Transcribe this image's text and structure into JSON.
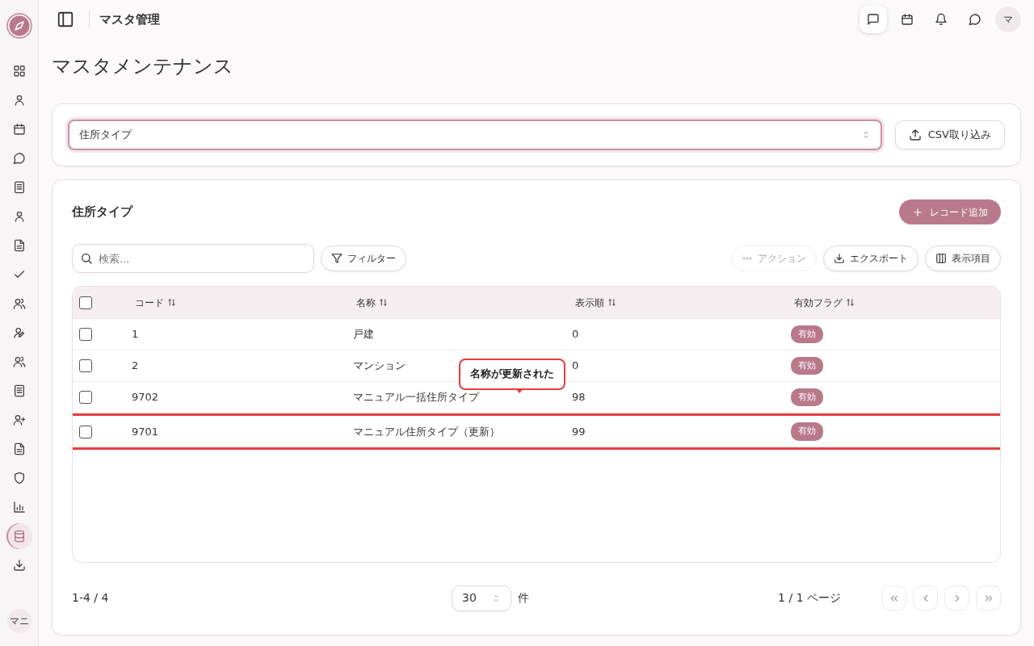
{
  "sidebar": {
    "items": [
      {
        "selected": false
      },
      {
        "selected": false
      },
      {
        "selected": false
      },
      {
        "selected": false
      },
      {
        "selected": false
      },
      {
        "selected": false
      },
      {
        "selected": false
      },
      {
        "selected": false
      },
      {
        "selected": false
      },
      {
        "selected": false
      },
      {
        "selected": false
      },
      {
        "selected": false
      },
      {
        "selected": false
      },
      {
        "selected": false
      },
      {
        "selected": false
      },
      {
        "selected": false
      },
      {
        "selected": true
      },
      {
        "selected": false
      }
    ],
    "user_avatar": "マニ"
  },
  "topbar": {
    "title": "マスタ管理",
    "avatar": "マ"
  },
  "page_title": "マスタメンテナンス",
  "master_select": {
    "value": "住所タイプ"
  },
  "import_button": "CSV取り込み",
  "section": {
    "title": "住所タイプ",
    "add_button": "レコード追加"
  },
  "search": {
    "placeholder": "検索..."
  },
  "filter_button": "フィルター",
  "toolbar": [
    {
      "label": "アクション",
      "disabled": true
    },
    {
      "label": "エクスポート",
      "disabled": false
    },
    {
      "label": "表示項目",
      "disabled": false
    }
  ],
  "table": {
    "select_all": {
      "checked": false
    },
    "columns": [
      "コード",
      "名称",
      "表示順",
      "有効フラグ"
    ],
    "rows": [
      {
        "checked": false,
        "highlighted": false,
        "cells": [
          "1",
          "戸建",
          "0",
          "有効"
        ]
      },
      {
        "checked": false,
        "highlighted": false,
        "cells": [
          "2",
          "マンション",
          "0",
          "有効"
        ]
      },
      {
        "checked": false,
        "highlighted": false,
        "cells": [
          "9702",
          "マニュアル一括住所タイプ",
          "98",
          "有効"
        ]
      },
      {
        "checked": false,
        "highlighted": true,
        "cells": [
          "9701",
          "マニュアル住所タイプ（更新）",
          "99",
          "有効"
        ],
        "tooltip": "名称が更新された"
      }
    ]
  },
  "footer": {
    "range": "1-4 / 4",
    "page_size": "30",
    "unit": "件",
    "page_info": "1 / 1 ページ",
    "pager": [
      {
        "kind": "first",
        "disabled": true
      },
      {
        "kind": "prev",
        "disabled": true
      },
      {
        "kind": "next",
        "disabled": true
      },
      {
        "kind": "last",
        "disabled": true
      }
    ]
  }
}
